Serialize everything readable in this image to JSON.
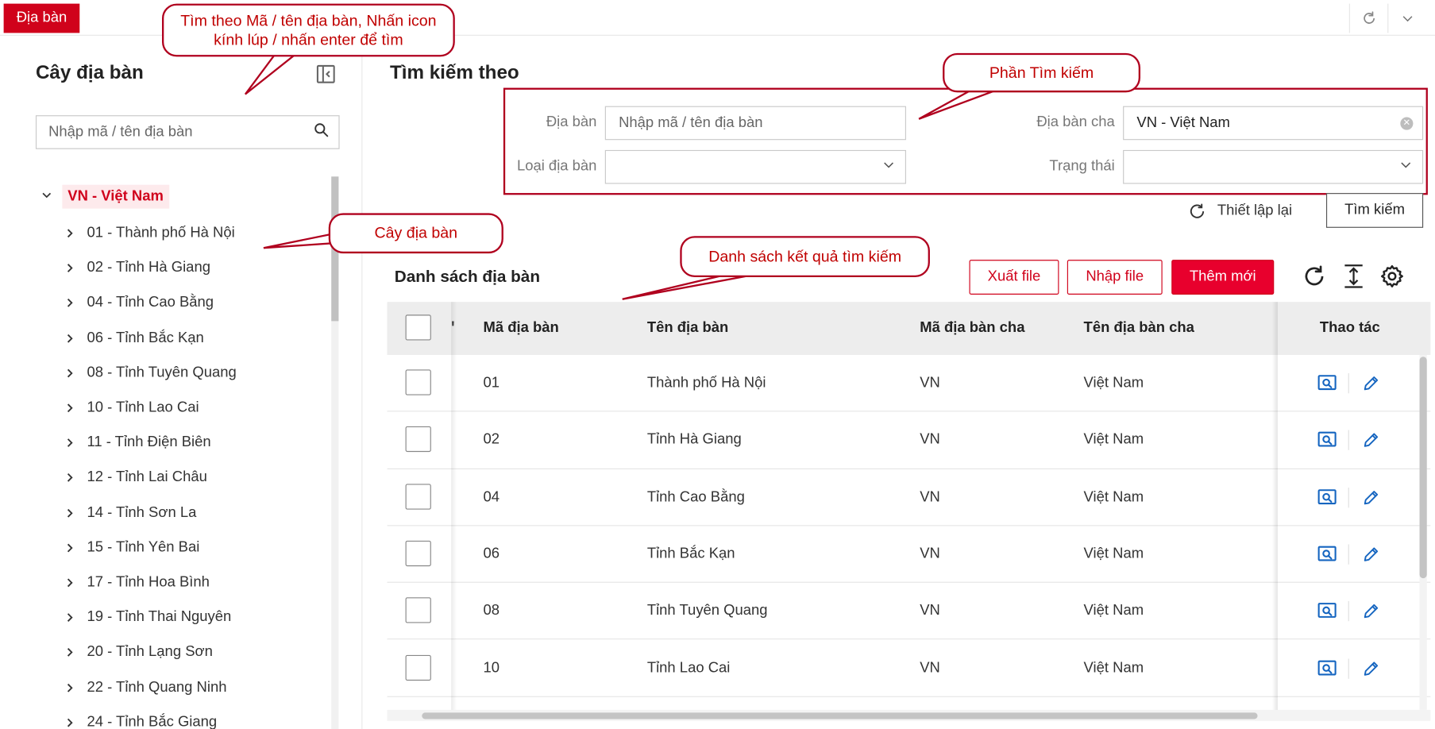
{
  "topbar": {
    "active_tab": "Địa bàn"
  },
  "tree": {
    "title": "Cây địa bàn",
    "search_placeholder": "Nhập mã / tên địa bàn",
    "root": "VN - Việt Nam",
    "items": [
      "01 - Thành phố Hà Nội",
      "02 - Tỉnh Hà Giang",
      "04 - Tỉnh Cao Bằng",
      "06 - Tỉnh Bắc Kạn",
      "08 - Tỉnh Tuyên Quang",
      "10 - Tỉnh Lao Cai",
      "11 - Tỉnh Điện Biên",
      "12 - Tỉnh Lai Châu",
      "14 - Tỉnh Sơn La",
      "15 - Tỉnh Yên Bai",
      "17 - Tỉnh Hoa Bình",
      "19 - Tỉnh Thai Nguyên",
      "20 - Tỉnh Lạng Sơn",
      "22 - Tỉnh Quang Ninh",
      "24 - Tỉnh Bắc Giang"
    ]
  },
  "search": {
    "title": "Tìm kiếm theo",
    "fields": {
      "dia_ban_label": "Địa bàn",
      "dia_ban_placeholder": "Nhập mã / tên địa bàn",
      "dia_ban_cha_label": "Địa bàn cha",
      "dia_ban_cha_value": "VN - Việt Nam",
      "loai_dia_ban_label": "Loại địa bàn",
      "trang_thai_label": "Trạng thái"
    },
    "reset_label": "Thiết lập lại",
    "search_label": "Tìm kiếm"
  },
  "list": {
    "title": "Danh sách địa bàn",
    "export_label": "Xuất file",
    "import_label": "Nhập file",
    "add_label": "Thêm mới",
    "columns": {
      "ma": "Mã địa bàn",
      "ten": "Tên địa bàn",
      "ma_cha": "Mã địa bàn cha",
      "ten_cha": "Tên địa bàn cha",
      "thao_tac": "Thao tác"
    },
    "rows": [
      {
        "ma": "01",
        "ten": "Thành phố Hà Nội",
        "ma_cha": "VN",
        "ten_cha": "Việt Nam"
      },
      {
        "ma": "02",
        "ten": "Tỉnh Hà Giang",
        "ma_cha": "VN",
        "ten_cha": "Việt Nam"
      },
      {
        "ma": "04",
        "ten": "Tỉnh Cao Bằng",
        "ma_cha": "VN",
        "ten_cha": "Việt Nam"
      },
      {
        "ma": "06",
        "ten": "Tỉnh Bắc Kạn",
        "ma_cha": "VN",
        "ten_cha": "Việt Nam"
      },
      {
        "ma": "08",
        "ten": "Tỉnh Tuyên Quang",
        "ma_cha": "VN",
        "ten_cha": "Việt Nam"
      },
      {
        "ma": "10",
        "ten": "Tỉnh Lao Cai",
        "ma_cha": "VN",
        "ten_cha": "Việt Nam"
      }
    ]
  },
  "callouts": {
    "search_hint": "Tìm theo Mã / tên địa bàn, Nhấn icon kính lúp / nhấn enter để tìm",
    "search_section": "Phần Tìm kiếm",
    "tree": "Cây địa bàn",
    "results": "Danh sách kết quả tìm kiếm"
  },
  "colors": {
    "brand_red": "#d0021b",
    "primary_button": "#e8002d",
    "callout_border": "#b0001e",
    "action_icon_blue": "#1565c0"
  }
}
